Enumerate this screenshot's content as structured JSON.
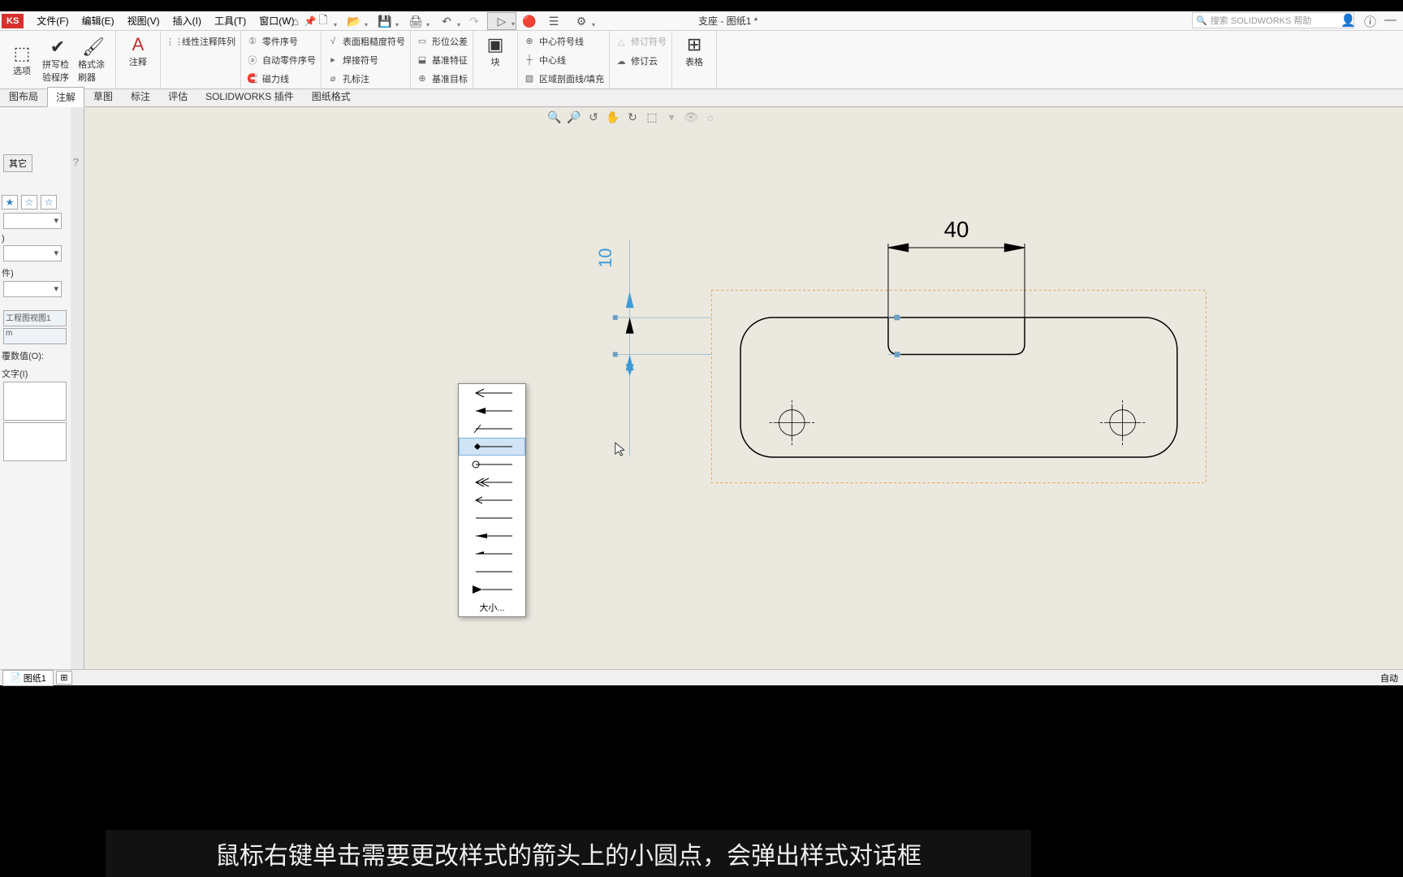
{
  "menus": {
    "file": "文件(F)",
    "edit": "编辑(E)",
    "view": "视图(V)",
    "insert": "插入(I)",
    "tools": "工具(T)",
    "window": "窗口(W)"
  },
  "doc_title": "支座 - 图纸1 *",
  "search_placeholder": "搜索 SOLIDWORKS 帮助",
  "ribbon": {
    "big1": "选项",
    "big2": "拼写检验程序",
    "big3": "格式涂刷器",
    "note": "注释",
    "linear_pattern": "线性注释阵列",
    "balloon": "零件序号",
    "auto_balloon": "自动零件序号",
    "magnetic": "磁力线",
    "surface_finish": "表面粗糙度符号",
    "weld": "焊接符号",
    "hole_callout": "孔标注",
    "geom_tol": "形位公差",
    "datum_feature": "基准特征",
    "datum_target": "基准目标",
    "block": "块",
    "center_mark": "中心符号线",
    "centerline": "中心线",
    "area_hatch": "区域剖面线/填充",
    "revision_symbol": "修订符号",
    "revision_cloud": "修订云",
    "table": "表格"
  },
  "tabs": {
    "layout": "图布局",
    "annotate": "注解",
    "sketch": "草图",
    "dimension": "标注",
    "evaluate": "评估",
    "addins": "SOLIDWORKS 插件",
    "sheet_format": "图纸格式"
  },
  "left_panel": {
    "other_tab": "其它",
    "view_name": "工程图视图1",
    "unit_suffix": "m",
    "override": "覆数值(O):",
    "text_section": "文字(I)"
  },
  "arrow_popup": {
    "size": "大小..."
  },
  "dimensions": {
    "top": "40",
    "left": "10"
  },
  "status": {
    "sheet": "图纸1",
    "right": "自动"
  },
  "subtitle": "鼠标右键单击需要更改样式的箭头上的小圆点，会弹出样式对话框"
}
